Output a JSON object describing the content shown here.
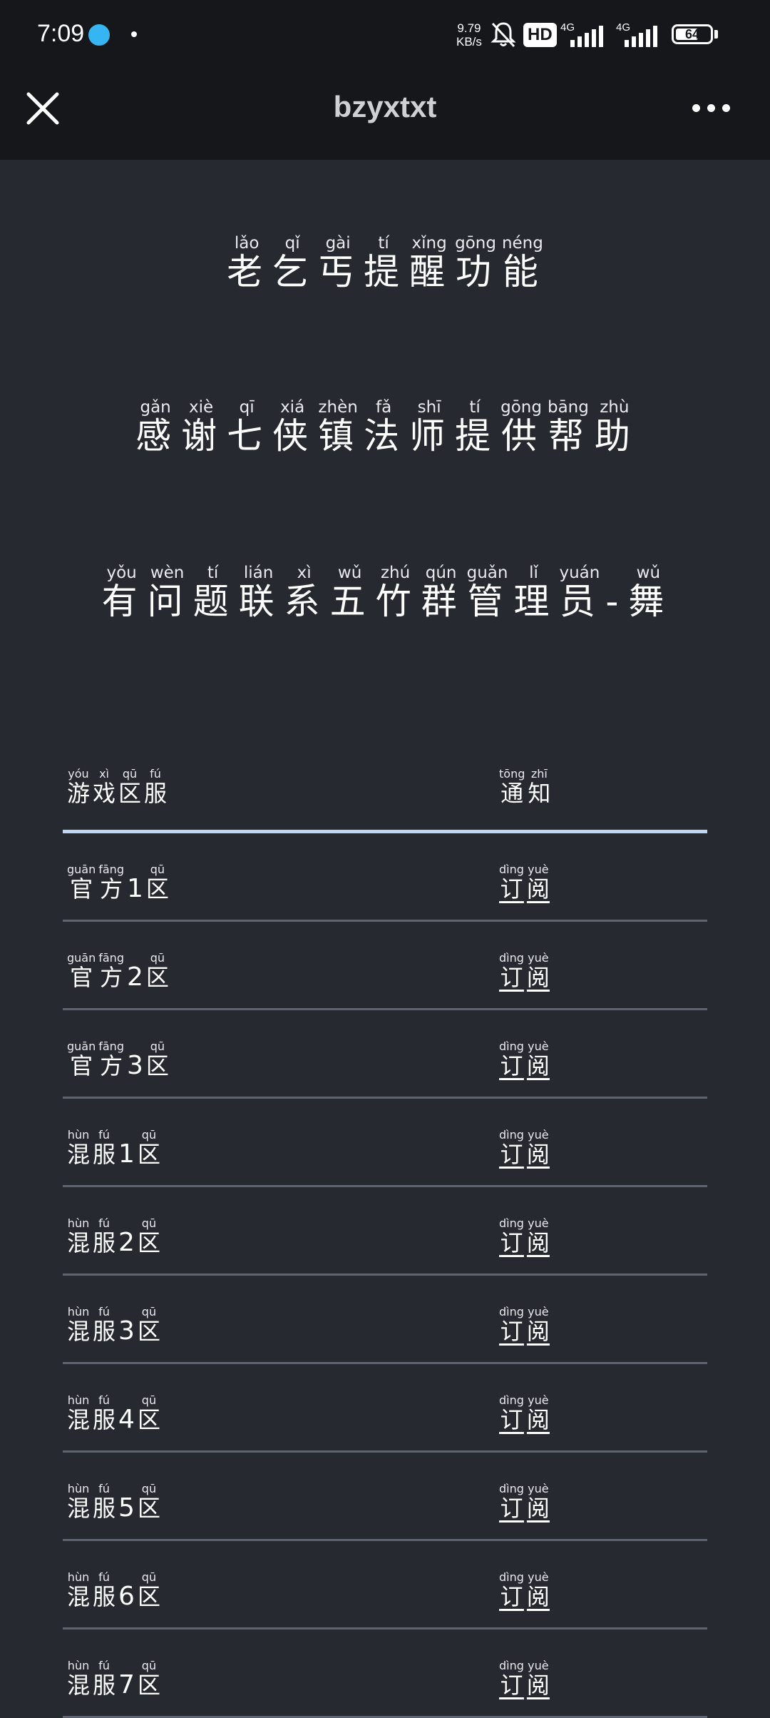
{
  "status_bar": {
    "time": "7:09",
    "net_speed_value": "9.79",
    "net_speed_unit": "KB/s",
    "hd_label": "HD",
    "net1": "4G",
    "net2": "4G",
    "battery": "64"
  },
  "header": {
    "title": "bzyxtxt"
  },
  "notices": [
    {
      "chars": [
        "老",
        "乞",
        "丐",
        "提",
        "醒",
        "功",
        "能"
      ],
      "pinyin": [
        "lǎo",
        "qǐ",
        "gài",
        "tí",
        "xǐng",
        "gōng",
        "néng"
      ]
    },
    {
      "chars": [
        "感",
        "谢",
        "七",
        "侠",
        "镇",
        "法",
        "师",
        "提",
        "供",
        "帮",
        "助"
      ],
      "pinyin": [
        "gǎn",
        "xiè",
        "qī",
        "xiá",
        "zhèn",
        "fǎ",
        "shī",
        "tí",
        "gōng",
        "bāng",
        "zhù"
      ]
    },
    {
      "chars": [
        "有",
        "问",
        "题",
        "联",
        "系",
        "五",
        "竹",
        "群",
        "管",
        "理",
        "员",
        "-",
        "舞"
      ],
      "pinyin": [
        "yǒu",
        "wèn",
        "tí",
        "lián",
        "xì",
        "wǔ",
        "zhú",
        "qún",
        "guǎn",
        "lǐ",
        "yuán",
        "",
        "wǔ"
      ]
    }
  ],
  "table": {
    "headers": {
      "zone": {
        "chars": [
          "游",
          "戏",
          "区",
          "服"
        ],
        "pinyin": [
          "yóu",
          "xì",
          "qū",
          "fú"
        ]
      },
      "notify": {
        "chars": [
          "通",
          "知"
        ],
        "pinyin": [
          "tōng",
          "zhī"
        ]
      }
    },
    "rows": [
      {
        "prefix_chars": [
          "官",
          "方"
        ],
        "prefix_pinyin": [
          "guān",
          "fāng"
        ],
        "number": "1",
        "suffix_char": "区",
        "suffix_pinyin": "qū"
      },
      {
        "prefix_chars": [
          "官",
          "方"
        ],
        "prefix_pinyin": [
          "guān",
          "fāng"
        ],
        "number": "2",
        "suffix_char": "区",
        "suffix_pinyin": "qū"
      },
      {
        "prefix_chars": [
          "官",
          "方"
        ],
        "prefix_pinyin": [
          "guān",
          "fāng"
        ],
        "number": "3",
        "suffix_char": "区",
        "suffix_pinyin": "qū"
      },
      {
        "prefix_chars": [
          "混",
          "服"
        ],
        "prefix_pinyin": [
          "hùn",
          "fú"
        ],
        "number": "1",
        "suffix_char": "区",
        "suffix_pinyin": "qū"
      },
      {
        "prefix_chars": [
          "混",
          "服"
        ],
        "prefix_pinyin": [
          "hùn",
          "fú"
        ],
        "number": "2",
        "suffix_char": "区",
        "suffix_pinyin": "qū"
      },
      {
        "prefix_chars": [
          "混",
          "服"
        ],
        "prefix_pinyin": [
          "hùn",
          "fú"
        ],
        "number": "3",
        "suffix_char": "区",
        "suffix_pinyin": "qū"
      },
      {
        "prefix_chars": [
          "混",
          "服"
        ],
        "prefix_pinyin": [
          "hùn",
          "fú"
        ],
        "number": "4",
        "suffix_char": "区",
        "suffix_pinyin": "qū"
      },
      {
        "prefix_chars": [
          "混",
          "服"
        ],
        "prefix_pinyin": [
          "hùn",
          "fú"
        ],
        "number": "5",
        "suffix_char": "区",
        "suffix_pinyin": "qū"
      },
      {
        "prefix_chars": [
          "混",
          "服"
        ],
        "prefix_pinyin": [
          "hùn",
          "fú"
        ],
        "number": "6",
        "suffix_char": "区",
        "suffix_pinyin": "qū"
      },
      {
        "prefix_chars": [
          "混",
          "服"
        ],
        "prefix_pinyin": [
          "hùn",
          "fú"
        ],
        "number": "7",
        "suffix_char": "区",
        "suffix_pinyin": "qū"
      }
    ],
    "action": {
      "chars": [
        "订",
        "阅"
      ],
      "pinyin": [
        "dìng",
        "yuè"
      ]
    }
  },
  "icons": [
    "app-notification-icon",
    "mute-bell-icon",
    "signal-icon",
    "battery-icon",
    "close-icon",
    "more-icon"
  ],
  "colors": {
    "background": "#272930",
    "bar": "#16171a",
    "header_rule": "#bfd6f0",
    "row_rule": "#5d6573"
  }
}
